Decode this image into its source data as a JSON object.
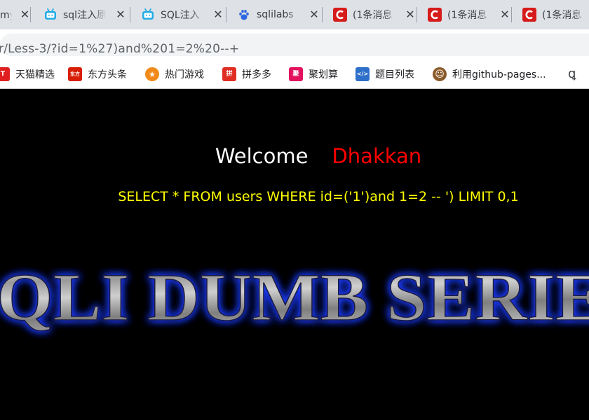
{
  "browser": {
    "tabs": [
      {
        "title": "mysql哪",
        "favicon": "generic-icon",
        "close": "✕"
      },
      {
        "title": "sql注入原",
        "favicon": "bilibili-icon",
        "close": "✕"
      },
      {
        "title": "SQL注入",
        "favicon": "bilibili-icon",
        "close": "✕"
      },
      {
        "title": "sqlilabs",
        "favicon": "baidu-paw-icon",
        "close": "✕"
      },
      {
        "title": "(1条消息",
        "favicon": "csdn-icon",
        "close": "✕"
      },
      {
        "title": "(1条消息",
        "favicon": "csdn-icon",
        "close": "✕"
      },
      {
        "title": "(1条消息",
        "favicon": "csdn-icon",
        "close": "✕"
      }
    ],
    "address": "r/Less-3/?id=1%27)and%201=2%20--+",
    "bookmarks": [
      {
        "label": "天猫精选",
        "icon_text": "T",
        "color": "#e02020"
      },
      {
        "label": "东方头条",
        "icon_text": "东方",
        "color": "#d81e06"
      },
      {
        "label": "热门游戏",
        "icon_text": "★",
        "color": "#f28a1b"
      },
      {
        "label": "拼多多",
        "icon_text": "拼",
        "color": "#e02e24"
      },
      {
        "label": "聚划算",
        "icon_text": "聚",
        "color": "#e3125f"
      },
      {
        "label": "题目列表",
        "icon_text": "</>",
        "color": "#2d6fc9"
      },
      {
        "label": "利用github-pages...",
        "icon_text": "☺",
        "color": "#8b5a2b"
      }
    ]
  },
  "page": {
    "welcome": "Welcome",
    "username": "Dhakkan",
    "query": "SELECT * FROM users WHERE id=('1')and 1=2 -- ') LIMIT 0,1",
    "banner_text": "SQLI DUMB SERIES"
  },
  "colors": {
    "page_bg": "#000000",
    "welcome": "#ffffff",
    "username": "#ff0000",
    "query": "#ffff00",
    "banner_glow": "#1f3cff"
  }
}
